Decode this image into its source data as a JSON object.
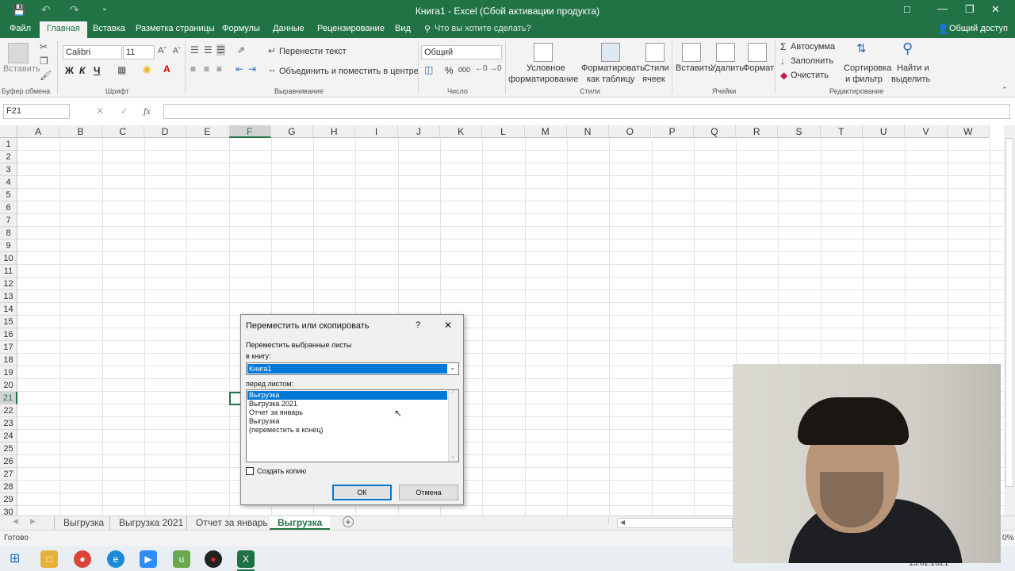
{
  "window": {
    "title": "Книга1 - Excel (Сбой активации продукта)"
  },
  "tabs": [
    {
      "label": "Файл"
    },
    {
      "label": "Главная"
    },
    {
      "label": "Вставка"
    },
    {
      "label": "Разметка страницы"
    },
    {
      "label": "Формулы"
    },
    {
      "label": "Данные"
    },
    {
      "label": "Рецензирование"
    },
    {
      "label": "Вид"
    }
  ],
  "tell_me": "Что вы хотите сделать?",
  "share": "Общий доступ",
  "ribbon": {
    "clipboard": {
      "paste": "Вставить",
      "group": "Буфер обмена"
    },
    "font": {
      "name": "Calibri",
      "size": "11",
      "bold": "Ж",
      "italic": "К",
      "underline": "Ч",
      "group": "Шрифт"
    },
    "alignment": {
      "wrap": "Перенести текст",
      "merge": "Объединить и поместить в центре",
      "group": "Выравнивание"
    },
    "number": {
      "format": "Общий",
      "percent": "%",
      "thousands": "000",
      "group": "Число"
    },
    "styles": {
      "cond_1": "Условное",
      "cond_2": "форматирование",
      "table_1": "Форматировать",
      "table_2": "как таблицу",
      "cell_1": "Стили",
      "cell_2": "ячеек",
      "group": "Стили"
    },
    "cells": {
      "insert": "Вставить",
      "delete": "Удалить",
      "format": "Формат",
      "group": "Ячейки"
    },
    "editing": {
      "autosum": "Автосумма",
      "fill": "Заполнить",
      "clear": "Очистить",
      "sort_1": "Сортировка",
      "sort_2": "и фильтр",
      "find_1": "Найти и",
      "find_2": "выделить",
      "group": "Редактирование"
    }
  },
  "formula_bar": {
    "name_box": "F21",
    "fx": "fx",
    "cancel": "✕",
    "confirm": "✓"
  },
  "columns": [
    "A",
    "B",
    "C",
    "D",
    "E",
    "F",
    "G",
    "H",
    "I",
    "J",
    "K",
    "L",
    "M",
    "N",
    "O",
    "P",
    "Q",
    "R",
    "S",
    "T",
    "U",
    "V",
    "W"
  ],
  "rows": [
    "1",
    "2",
    "3",
    "4",
    "5",
    "6",
    "7",
    "8",
    "9",
    "10",
    "11",
    "12",
    "13",
    "14",
    "15",
    "16",
    "17",
    "18",
    "19",
    "20",
    "21",
    "22",
    "23",
    "24",
    "25",
    "26",
    "27",
    "28",
    "29",
    "30"
  ],
  "sheets": [
    {
      "label": "Выгрузка"
    },
    {
      "label": "Выгрузка 2021"
    },
    {
      "label": "Отчет за январь"
    },
    {
      "label": "Выгрузка"
    }
  ],
  "status": {
    "ready": "Готово",
    "zoom": "0%"
  },
  "taskbar": {
    "date": "13.02.2021"
  },
  "dialog": {
    "title": "Переместить или скопировать",
    "help": "?",
    "close": "✕",
    "move_label": "Переместить выбранные листы",
    "to_book_label": "в книгу:",
    "book": "Книга1",
    "before_label": "перед листом:",
    "list": [
      "Выгрузка",
      "Выгрузка 2021",
      "Отчет за январь",
      "Выгрузка",
      "(переместить в конец)"
    ],
    "copy_label": "Создать копию",
    "ok": "ОК",
    "cancel": "Отмена"
  }
}
